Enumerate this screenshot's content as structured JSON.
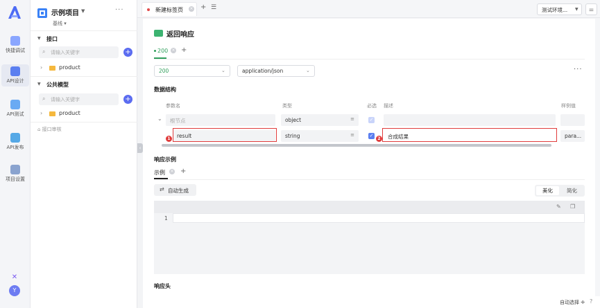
{
  "rail": {
    "items": [
      {
        "label": "快捷调试",
        "color": "#6b8cff"
      },
      {
        "label": "API设计",
        "color": "#5b7ff0"
      },
      {
        "label": "API测试",
        "color": "#5aa0f0"
      },
      {
        "label": "API发布",
        "color": "#4fa3e0"
      },
      {
        "label": "项目设置",
        "color": "#7a9ad0"
      }
    ],
    "avatar": "Y"
  },
  "tree": {
    "project_title": "示例项目",
    "branch": "基线",
    "interfaces_title": "接口",
    "search_placeholder": "请输入关键字",
    "folder_label": "product",
    "models_title": "公共模型",
    "models_search_placeholder": "请输入关键字",
    "models_folder_label": "product",
    "recycle": "接口审核"
  },
  "tabbar": {
    "tab_label": "新建标签页",
    "env_label": "测试环境..."
  },
  "main": {
    "title": "返回响应",
    "code_tab": "200",
    "status_select": "200",
    "content_type": "application/json",
    "data_structure_label": "数据结构",
    "columns": {
      "name": "参数名",
      "type": "类型",
      "required": "必选",
      "desc": "描述",
      "example": "样例值"
    },
    "rows": [
      {
        "name": "根节点",
        "type": "object",
        "desc": "",
        "example": ""
      },
      {
        "name": "result",
        "type": "string",
        "desc": "合成结果",
        "example": "para..."
      }
    ],
    "badges": [
      "1",
      "2"
    ],
    "response_example_label": "响应示例",
    "example_tab": "示例",
    "autogen_label": "自动生成",
    "beautify": "美化",
    "simplify": "简化",
    "line_number": "1",
    "response_header_label": "响应头",
    "auto_select": "自动选择"
  }
}
